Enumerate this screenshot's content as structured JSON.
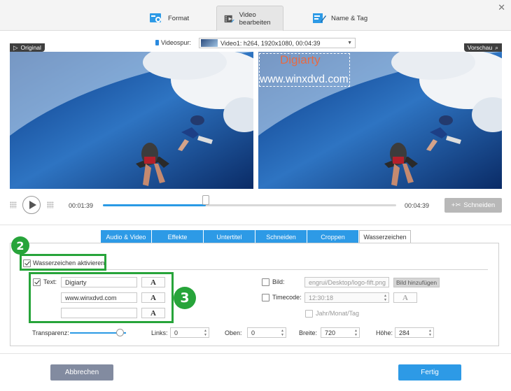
{
  "window": {
    "close_glyph": "✕"
  },
  "top_tabs": [
    {
      "label": "Format",
      "icon": "format-settings-icon"
    },
    {
      "label": "Video bearbeiten",
      "icon": "video-edit-icon"
    },
    {
      "label": "Name & Tag",
      "icon": "name-tag-edit-icon"
    }
  ],
  "video_track": {
    "label": "Videospur:",
    "value": "Video1: h264, 1920x1080, 00:04:39"
  },
  "preview": {
    "original_label": "Original",
    "preview_label": "Vorschau",
    "watermark_line1": "Digiarty",
    "watermark_line2": "www.winxdvd.com"
  },
  "playback": {
    "current_time": "00:01:39",
    "total_time": "00:04:39",
    "progress": 0.35,
    "cut_label": "Schneiden"
  },
  "edit_tabs": [
    {
      "label": "Audio & Video",
      "active": false
    },
    {
      "label": "Effekte",
      "active": false
    },
    {
      "label": "Untertitel",
      "active": false
    },
    {
      "label": "Schneiden",
      "active": false
    },
    {
      "label": "Croppen",
      "active": false
    },
    {
      "label": "Wasserzeichen",
      "active": true
    }
  ],
  "watermark": {
    "enable_label": "Wasserzeichen aktivieren",
    "enabled": true,
    "text_label": "Text:",
    "text_enabled": true,
    "text_lines": [
      "Digiarty",
      "www.winxdvd.com",
      ""
    ],
    "font_button": "A",
    "image_label": "Bild:",
    "image_path": "engrui/Desktop/logo-fift.png",
    "add_image_label": "Bild hinzufügen",
    "timecode_label": "Timecode:",
    "timecode_value": "12:30:18",
    "date_label": "Jahr/Monat/Tag",
    "transparency_label": "Transparenz:",
    "transparency": 0.85,
    "left_label": "Links:",
    "left_value": "0",
    "top_label": "Oben:",
    "top_value": "0",
    "width_label": "Breite:",
    "width_value": "720",
    "height_label": "Höhe:",
    "height_value": "284"
  },
  "annotations": {
    "badge_2": "2",
    "badge_3": "3",
    "color": "#27a43a"
  },
  "footer": {
    "cancel_label": "Abbrechen",
    "ok_label": "Fertig"
  },
  "colors": {
    "accent": "#2d9ae6",
    "cancel": "#828ba0",
    "watermark_title": "#e56b45"
  }
}
